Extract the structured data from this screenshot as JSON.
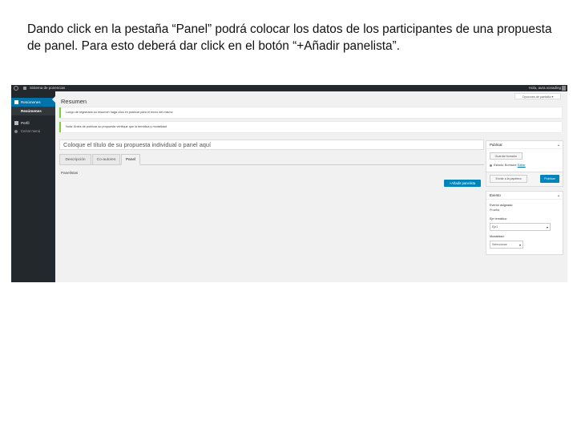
{
  "caption": "Dando click en la pestaña “Panel” podrá colocar los datos de los participantes de una propuesta de panel. Para esto deberá dar click en el botón “+Añadir panelista”.",
  "adminbar": {
    "site": "Sistema de ponencias",
    "user": "Hola, aura.sonading"
  },
  "sidebar": {
    "items": [
      {
        "label": "Resúmenes"
      },
      {
        "label": "Resúmenes"
      },
      {
        "label": "Perfil"
      },
      {
        "label": "Cerrar menú"
      }
    ]
  },
  "screen_options": "Opciones de pantalla ▾",
  "page_title": "Resumen",
  "notices": [
    "Luego de registrado su resumen haga click en publicar para el envío del mismo",
    "Nota: Antes de publicar su propuesta verifique que la temática y modalidad"
  ],
  "title_placeholder": "Coloque el título de su propuesta individual o panel aquí",
  "tabs": [
    {
      "label": "Descripción"
    },
    {
      "label": "Co-autores"
    },
    {
      "label": "Panel"
    }
  ],
  "panel_section_label": "Panelistas",
  "add_panelist": "+Añadir panelista",
  "publish_box": {
    "title": "Publicar",
    "save_draft": "Guardar borrador",
    "status_label": "Estado: Borrador",
    "edit_link": "Editar",
    "trash": "Enviar a la papelera",
    "publish": "Publicar"
  },
  "event_box": {
    "title": "Evento",
    "event_label": "Evento asignado:",
    "event_value": "Prueba",
    "theme_label": "Eje temático:",
    "theme_value": "Eje1",
    "modality_label": "Modalidad:",
    "modality_value": "Seleccionar"
  },
  "colors": {
    "admin_dark": "#23282d",
    "accent_blue": "#0073aa",
    "button_blue": "#0085ba",
    "notice_green": "#7ad03a"
  }
}
